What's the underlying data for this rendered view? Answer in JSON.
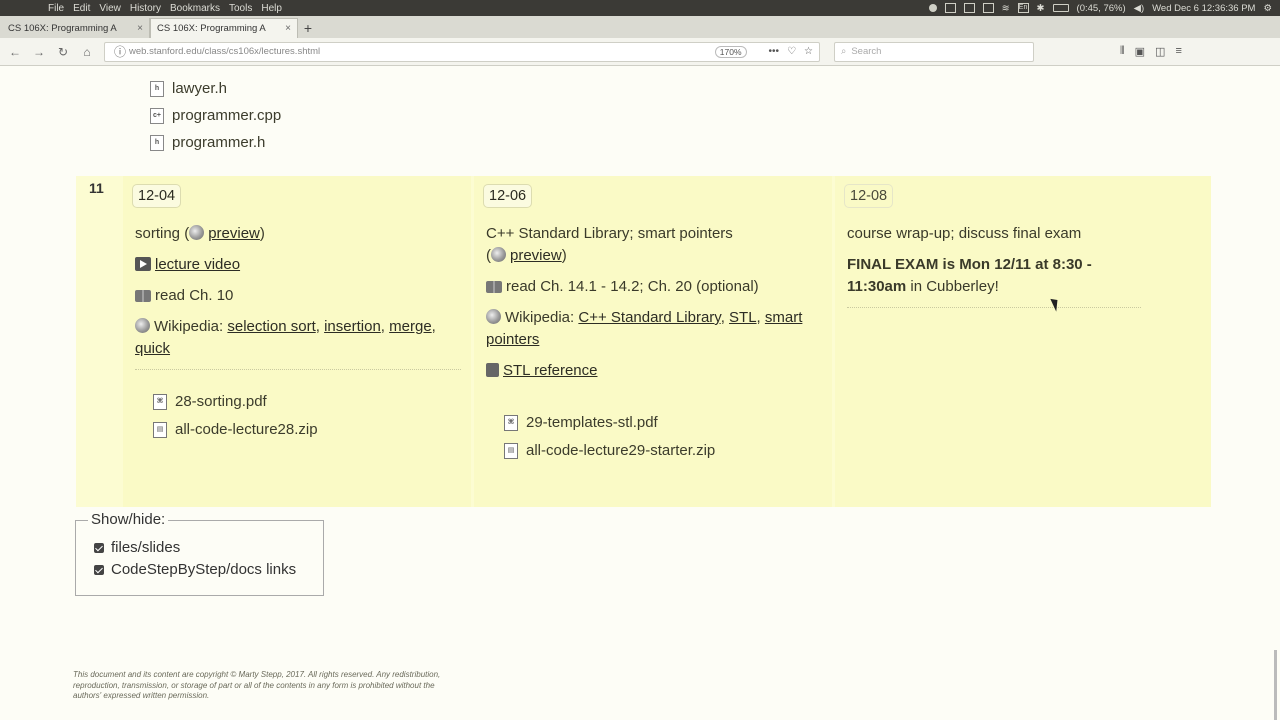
{
  "os_bar": {
    "menu": [
      "File",
      "Edit",
      "View",
      "History",
      "Bookmarks",
      "Tools",
      "Help"
    ],
    "keyboard": "En",
    "battery": "(0:45, 76%)",
    "clock": "Wed Dec 6  12:36:36 PM"
  },
  "browser": {
    "tabs": [
      {
        "title": "CS 106X: Programming A"
      },
      {
        "title": "CS 106X: Programming A"
      }
    ],
    "new_tab": "+",
    "url": "web.stanford.edu/class/cs106x/lectures.shtml",
    "zoom": "170%",
    "search_placeholder": "Search"
  },
  "top_files": [
    {
      "name": "lawyer.h",
      "type": "h"
    },
    {
      "name": "programmer.cpp",
      "type": "cpp"
    },
    {
      "name": "programmer.h",
      "type": "h"
    }
  ],
  "week": {
    "number": "11",
    "days": [
      {
        "date": "12-04",
        "topic": "sorting (",
        "preview_label": "preview",
        "topic_close": ")",
        "video_label": "lecture video",
        "reading": "read Ch. 10",
        "wiki_prefix": "Wikipedia:",
        "wiki_links": [
          "selection sort",
          "insertion",
          "merge",
          "quick"
        ],
        "files": [
          "28-sorting.pdf",
          "all-code-lecture28.zip"
        ]
      },
      {
        "date": "12-06",
        "topic": "C++ Standard Library; smart pointers",
        "preview_open": "(",
        "preview_label": "preview",
        "topic_close": ")",
        "reading": "read Ch. 14.1 - 14.2; Ch. 20 (optional)",
        "wiki_prefix": "Wikipedia:",
        "wiki_links": [
          "C++ Standard Library",
          "STL",
          "smart pointers"
        ],
        "reference_label": "STL reference",
        "files": [
          "29-templates-stl.pdf",
          "all-code-lecture29-starter.zip"
        ]
      },
      {
        "date": "12-08",
        "topic": "course wrap-up; discuss final exam",
        "exam_bold": "FINAL EXAM is Mon 12/11 at 8:30 - 11:30am",
        "exam_rest": " in Cubberley!"
      }
    ]
  },
  "show_hide": {
    "legend": "Show/hide:",
    "options": [
      "files/slides",
      "CodeStepByStep/docs links"
    ]
  },
  "copyright": "This document and its content are copyright © Marty Stepp, 2017. All rights reserved. Any redistribution, reproduction, transmission, or storage of part or all of the contents in any form is prohibited without the authors' expressed written permission."
}
